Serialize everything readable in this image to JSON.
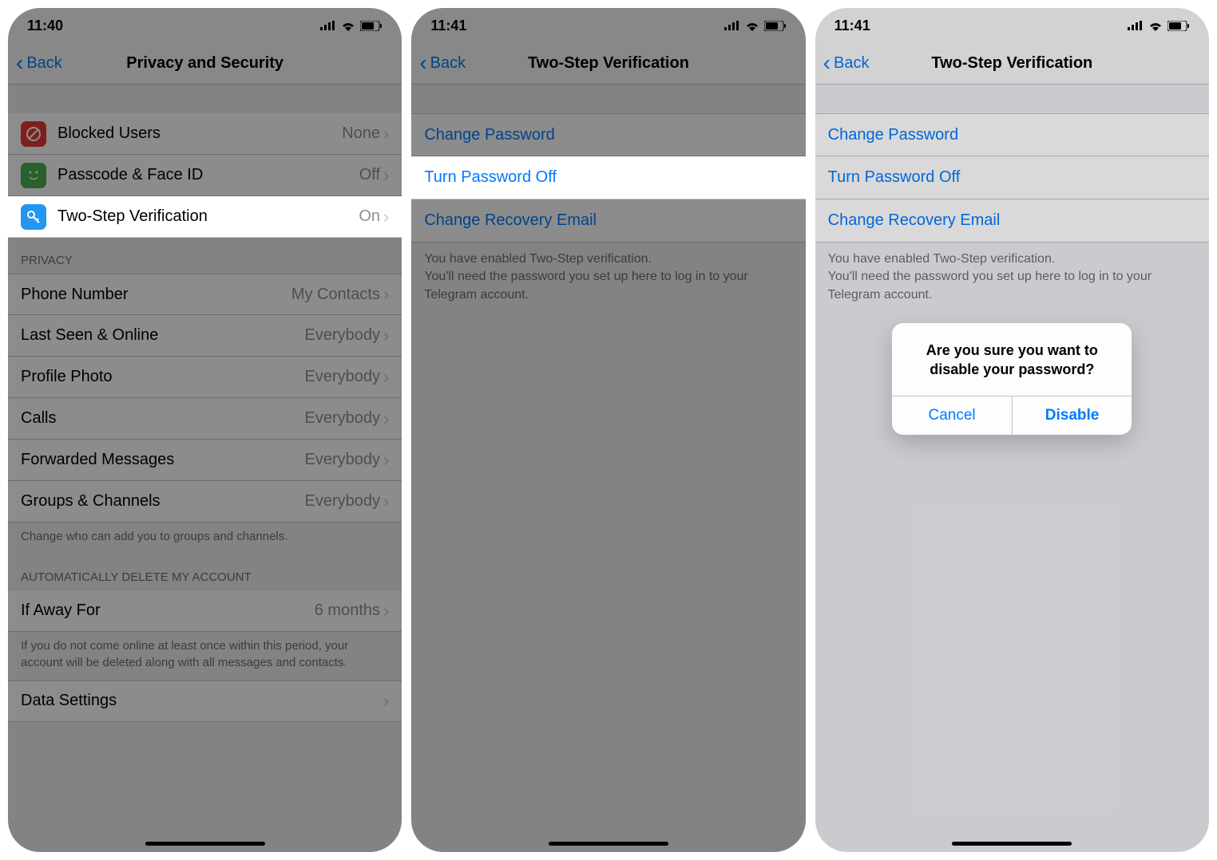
{
  "accent": "#007aff",
  "screen1": {
    "time": "11:40",
    "back": "Back",
    "title": "Privacy and Security",
    "security": [
      {
        "icon_bg": "#e53935",
        "icon": "blocked",
        "label": "Blocked Users",
        "value": "None"
      },
      {
        "icon_bg": "#4caf50",
        "icon": "passcode",
        "label": "Passcode & Face ID",
        "value": "Off"
      },
      {
        "icon_bg": "#2196f3",
        "icon": "key",
        "label": "Two-Step Verification",
        "value": "On",
        "highlight": true
      }
    ],
    "privacy_header": "Privacy",
    "privacy": [
      {
        "label": "Phone Number",
        "value": "My Contacts"
      },
      {
        "label": "Last Seen & Online",
        "value": "Everybody"
      },
      {
        "label": "Profile Photo",
        "value": "Everybody"
      },
      {
        "label": "Calls",
        "value": "Everybody"
      },
      {
        "label": "Forwarded Messages",
        "value": "Everybody"
      },
      {
        "label": "Groups & Channels",
        "value": "Everybody"
      }
    ],
    "privacy_footer": "Change who can add you to groups and channels.",
    "auto_header": "Automatically delete my account",
    "auto_row": {
      "label": "If Away For",
      "value": "6 months"
    },
    "auto_footer": "If you do not come online at least once within this period, your account will be deleted along with all messages and contacts.",
    "data_settings": "Data Settings"
  },
  "screen2": {
    "time": "11:41",
    "back": "Back",
    "title": "Two-Step Verification",
    "links": [
      {
        "label": "Change Password"
      },
      {
        "label": "Turn Password Off",
        "highlight": true
      },
      {
        "label": "Change Recovery Email"
      }
    ],
    "desc": "You have enabled Two-Step verification.\nYou'll need the password you set up here to log in to your Telegram account."
  },
  "screen3": {
    "time": "11:41",
    "back": "Back",
    "title": "Two-Step Verification",
    "links": [
      {
        "label": "Change Password"
      },
      {
        "label": "Turn Password Off"
      },
      {
        "label": "Change Recovery Email"
      }
    ],
    "desc": "You have enabled Two-Step verification.\nYou'll need the password you set up here to log in to your Telegram account.",
    "alert": {
      "message": "Are you sure you want to disable your password?",
      "cancel": "Cancel",
      "confirm": "Disable"
    }
  }
}
